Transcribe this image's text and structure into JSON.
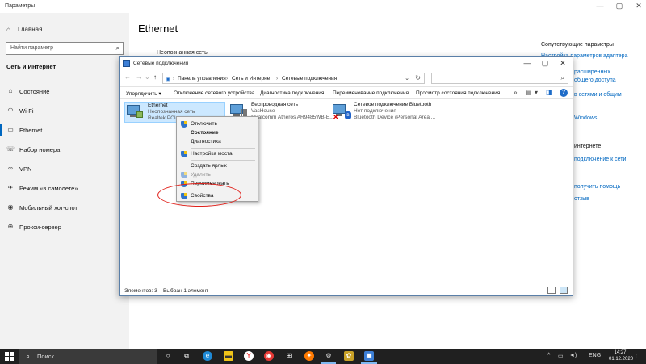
{
  "settings": {
    "window_title": "Параметры",
    "home_label": "Главная",
    "search_placeholder": "Найти параметр",
    "section_label": "Сеть и Интернет",
    "nav": [
      {
        "label": "Состояние",
        "icon": "home-globe-icon"
      },
      {
        "label": "Wi-Fi",
        "icon": "wifi-icon"
      },
      {
        "label": "Ethernet",
        "icon": "ethernet-icon"
      },
      {
        "label": "Набор номера",
        "icon": "phone-icon"
      },
      {
        "label": "VPN",
        "icon": "vpn-icon"
      },
      {
        "label": "Режим «в самолете»",
        "icon": "airplane-icon"
      },
      {
        "label": "Мобильный хот-спот",
        "icon": "hotspot-icon"
      },
      {
        "label": "Прокси-сервер",
        "icon": "globe-icon"
      }
    ],
    "active_nav": "Ethernet",
    "page_title": "Ethernet",
    "eth_status": "Неопознанная сеть",
    "eth_sub": "",
    "related_title": "Сопутствующие параметры",
    "related_links": [
      "Настройка параметров адаптера",
      "расширенных",
      "общего доступа",
      "в сетями и общим",
      "Windows"
    ],
    "related_text": [
      "интернете"
    ],
    "related_links2": [
      "подключение к сети",
      "получить помощь",
      "отзыв"
    ]
  },
  "explorer": {
    "title": "Сетевые подключения",
    "breadcrumb": [
      "Панель управления",
      "Сеть и Интернет",
      "Сетевые подключения"
    ],
    "toolbar": [
      "Упорядочить ▾",
      "Отключение сетевого устройства",
      "Диагностика подключения",
      "Переименование подключения",
      "Просмотр состояния подключения"
    ],
    "adapters": [
      {
        "name": "Ethernet",
        "status": "Неопознанная сеть",
        "device": "Realtek PCIe"
      },
      {
        "name": "Беспроводная сеть",
        "status": "VasHouse",
        "device": "Qualcomm Atheros AR9485WB-E..."
      },
      {
        "name": "Сетевое подключение Bluetooth",
        "status": "Нет подключения",
        "device": "Bluetooth Device (Personal Area ..."
      }
    ],
    "status_count": "Элементов: 3",
    "status_selected": "Выбран 1 элемент"
  },
  "context_menu": {
    "items": [
      "Отключить",
      "Состояние",
      "Диагностика",
      "Настройка моста",
      "Создать ярлык",
      "Удалить",
      "Переименовать",
      "Свойства"
    ]
  },
  "taskbar": {
    "search_label": "Поиск",
    "lang": "ENG",
    "time": "14:27",
    "date": "01.12.2020"
  }
}
